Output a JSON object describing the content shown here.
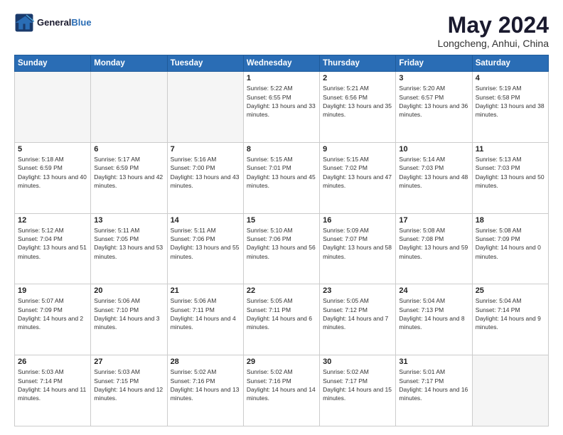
{
  "header": {
    "logo_line1": "General",
    "logo_line2": "Blue",
    "title": "May 2024",
    "subtitle": "Longcheng, Anhui, China"
  },
  "weekdays": [
    "Sunday",
    "Monday",
    "Tuesday",
    "Wednesday",
    "Thursday",
    "Friday",
    "Saturday"
  ],
  "weeks": [
    [
      {
        "num": "",
        "empty": true
      },
      {
        "num": "",
        "empty": true
      },
      {
        "num": "",
        "empty": true
      },
      {
        "num": "1",
        "sunrise": "5:22 AM",
        "sunset": "6:55 PM",
        "daylight": "13 hours and 33 minutes."
      },
      {
        "num": "2",
        "sunrise": "5:21 AM",
        "sunset": "6:56 PM",
        "daylight": "13 hours and 35 minutes."
      },
      {
        "num": "3",
        "sunrise": "5:20 AM",
        "sunset": "6:57 PM",
        "daylight": "13 hours and 36 minutes."
      },
      {
        "num": "4",
        "sunrise": "5:19 AM",
        "sunset": "6:58 PM",
        "daylight": "13 hours and 38 minutes."
      }
    ],
    [
      {
        "num": "5",
        "sunrise": "5:18 AM",
        "sunset": "6:59 PM",
        "daylight": "13 hours and 40 minutes."
      },
      {
        "num": "6",
        "sunrise": "5:17 AM",
        "sunset": "6:59 PM",
        "daylight": "13 hours and 42 minutes."
      },
      {
        "num": "7",
        "sunrise": "5:16 AM",
        "sunset": "7:00 PM",
        "daylight": "13 hours and 43 minutes."
      },
      {
        "num": "8",
        "sunrise": "5:15 AM",
        "sunset": "7:01 PM",
        "daylight": "13 hours and 45 minutes."
      },
      {
        "num": "9",
        "sunrise": "5:15 AM",
        "sunset": "7:02 PM",
        "daylight": "13 hours and 47 minutes."
      },
      {
        "num": "10",
        "sunrise": "5:14 AM",
        "sunset": "7:03 PM",
        "daylight": "13 hours and 48 minutes."
      },
      {
        "num": "11",
        "sunrise": "5:13 AM",
        "sunset": "7:03 PM",
        "daylight": "13 hours and 50 minutes."
      }
    ],
    [
      {
        "num": "12",
        "sunrise": "5:12 AM",
        "sunset": "7:04 PM",
        "daylight": "13 hours and 51 minutes."
      },
      {
        "num": "13",
        "sunrise": "5:11 AM",
        "sunset": "7:05 PM",
        "daylight": "13 hours and 53 minutes."
      },
      {
        "num": "14",
        "sunrise": "5:11 AM",
        "sunset": "7:06 PM",
        "daylight": "13 hours and 55 minutes."
      },
      {
        "num": "15",
        "sunrise": "5:10 AM",
        "sunset": "7:06 PM",
        "daylight": "13 hours and 56 minutes."
      },
      {
        "num": "16",
        "sunrise": "5:09 AM",
        "sunset": "7:07 PM",
        "daylight": "13 hours and 58 minutes."
      },
      {
        "num": "17",
        "sunrise": "5:08 AM",
        "sunset": "7:08 PM",
        "daylight": "13 hours and 59 minutes."
      },
      {
        "num": "18",
        "sunrise": "5:08 AM",
        "sunset": "7:09 PM",
        "daylight": "14 hours and 0 minutes."
      }
    ],
    [
      {
        "num": "19",
        "sunrise": "5:07 AM",
        "sunset": "7:09 PM",
        "daylight": "14 hours and 2 minutes."
      },
      {
        "num": "20",
        "sunrise": "5:06 AM",
        "sunset": "7:10 PM",
        "daylight": "14 hours and 3 minutes."
      },
      {
        "num": "21",
        "sunrise": "5:06 AM",
        "sunset": "7:11 PM",
        "daylight": "14 hours and 4 minutes."
      },
      {
        "num": "22",
        "sunrise": "5:05 AM",
        "sunset": "7:11 PM",
        "daylight": "14 hours and 6 minutes."
      },
      {
        "num": "23",
        "sunrise": "5:05 AM",
        "sunset": "7:12 PM",
        "daylight": "14 hours and 7 minutes."
      },
      {
        "num": "24",
        "sunrise": "5:04 AM",
        "sunset": "7:13 PM",
        "daylight": "14 hours and 8 minutes."
      },
      {
        "num": "25",
        "sunrise": "5:04 AM",
        "sunset": "7:14 PM",
        "daylight": "14 hours and 9 minutes."
      }
    ],
    [
      {
        "num": "26",
        "sunrise": "5:03 AM",
        "sunset": "7:14 PM",
        "daylight": "14 hours and 11 minutes."
      },
      {
        "num": "27",
        "sunrise": "5:03 AM",
        "sunset": "7:15 PM",
        "daylight": "14 hours and 12 minutes."
      },
      {
        "num": "28",
        "sunrise": "5:02 AM",
        "sunset": "7:16 PM",
        "daylight": "14 hours and 13 minutes."
      },
      {
        "num": "29",
        "sunrise": "5:02 AM",
        "sunset": "7:16 PM",
        "daylight": "14 hours and 14 minutes."
      },
      {
        "num": "30",
        "sunrise": "5:02 AM",
        "sunset": "7:17 PM",
        "daylight": "14 hours and 15 minutes."
      },
      {
        "num": "31",
        "sunrise": "5:01 AM",
        "sunset": "7:17 PM",
        "daylight": "14 hours and 16 minutes."
      },
      {
        "num": "",
        "empty": true
      }
    ]
  ],
  "labels": {
    "sunrise": "Sunrise:",
    "sunset": "Sunset:",
    "daylight": "Daylight:"
  },
  "colors": {
    "header_bg": "#2a6db5",
    "alt_row_bg": "#f0f4fa"
  }
}
